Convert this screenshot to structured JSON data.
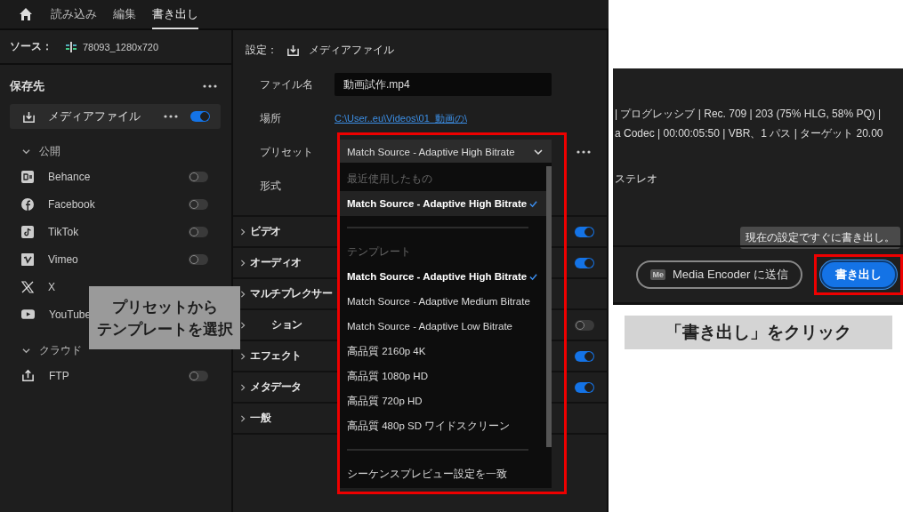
{
  "top_tabs": [
    {
      "label": "読み込み",
      "selected": false
    },
    {
      "label": "編集",
      "selected": false
    },
    {
      "label": "書き出し",
      "selected": true
    }
  ],
  "source": {
    "label": "ソース：",
    "value": "78093_1280x720"
  },
  "destinations": {
    "title": "保存先",
    "media_file": {
      "label": "メディアファイル",
      "on": true
    },
    "groups": [
      {
        "label": "公開",
        "expanded": true,
        "items": [
          {
            "kind": "behance",
            "label": "Behance",
            "on": false
          },
          {
            "kind": "facebook",
            "label": "Facebook",
            "on": false
          },
          {
            "kind": "tiktok",
            "label": "TikTok",
            "on": false
          },
          {
            "kind": "vimeo",
            "label": "Vimeo",
            "on": false
          },
          {
            "kind": "x",
            "label": "X"
          },
          {
            "kind": "youtube",
            "label": "YouTube"
          }
        ]
      },
      {
        "label": "クラウド",
        "expanded": true,
        "items": [
          {
            "kind": "ftp",
            "label": "FTP",
            "on": false
          }
        ]
      }
    ]
  },
  "settings": {
    "title": "設定：",
    "target": "メディアファイル",
    "fields": [
      {
        "kind": "input",
        "label": "ファイル名",
        "value": "動画試作.mp4"
      },
      {
        "kind": "link",
        "label": "場所",
        "value": "C:\\User..eu\\Videos\\01_動画の\\"
      },
      {
        "kind": "dropdown",
        "label": "プリセット",
        "value": "Match Source - Adaptive High Bitrate"
      },
      {
        "kind": "empty",
        "label": "形式"
      }
    ],
    "sections": [
      {
        "kind": "full",
        "label": "ビデオ",
        "on": true
      },
      {
        "kind": "full",
        "label": "オーディオ",
        "on": true
      },
      {
        "kind": "full",
        "label": "マルチプレクサー"
      },
      {
        "kind": "clipped",
        "label": "ション",
        "on": false
      },
      {
        "kind": "full",
        "label": "エフェクト",
        "on": true
      },
      {
        "kind": "full",
        "label": "メタデータ",
        "on": true
      },
      {
        "kind": "full",
        "label": "一般"
      }
    ]
  },
  "preset_menu": {
    "groups": [
      {
        "heading": "最近使用したもの",
        "items": [
          {
            "label": "Match Source - Adaptive High Bitrate",
            "selected": true,
            "hovered": true
          }
        ]
      },
      {
        "heading": "テンプレート",
        "items": [
          {
            "label": "Match Source - Adaptive High Bitrate",
            "selected": true,
            "hovered": false
          },
          {
            "label": "Match Source - Adaptive Medium Bitrate",
            "selected": false,
            "hovered": false
          },
          {
            "label": "Match Source - Adaptive Low Bitrate",
            "selected": false,
            "hovered": false
          },
          {
            "label": "高品質 2160p 4K",
            "selected": false,
            "hovered": false
          },
          {
            "label": "高品質 1080p HD",
            "selected": false,
            "hovered": false
          },
          {
            "label": "高品質 720p HD",
            "selected": false,
            "hovered": false
          },
          {
            "label": "高品質 480p SD ワイドスクリーン",
            "selected": false,
            "hovered": false
          }
        ]
      },
      {
        "items": [
          {
            "label": "シーケンスプレビュー設定を一致",
            "selected": false,
            "hovered": false
          }
        ]
      }
    ]
  },
  "export_panel": {
    "summary_lines": [
      "| プログレッシブ | Rec. 709 | 203 (75% HLG, 58% PQ) |",
      "a Codec | 00:00:05:50  | VBR、1 パス | ターゲット 20.00"
    ],
    "audio": "ステレオ",
    "tooltip": "現在の設定ですぐに書き出し。",
    "send_icon_label": "Me",
    "send_button": "Media Encoder に送信",
    "export_button": "書き出し"
  },
  "annotations": {
    "preset_caption": [
      "プリセットから",
      "テンプレートを選択"
    ],
    "export_caption": "「書き出し」をクリック"
  }
}
